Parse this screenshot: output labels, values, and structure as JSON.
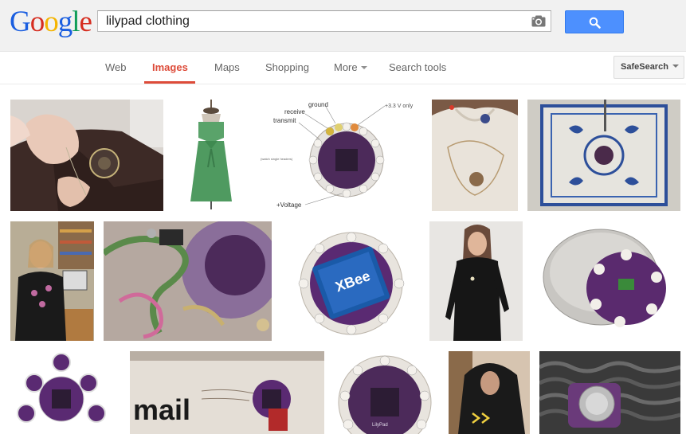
{
  "logo": {
    "letters": [
      "G",
      "o",
      "o",
      "g",
      "l",
      "e"
    ],
    "colors": [
      "#1a5ee0",
      "#d62d20",
      "#f4b400",
      "#1a5ee0",
      "#0f9d58",
      "#d62d20"
    ]
  },
  "search": {
    "query": "lilypad clothing",
    "camera_icon": "camera-icon",
    "button_icon": "magnifier-icon"
  },
  "nav": {
    "items": [
      {
        "label": "Web"
      },
      {
        "label": "Images",
        "active": true
      },
      {
        "label": "Maps"
      },
      {
        "label": "Shopping"
      },
      {
        "label": "More"
      },
      {
        "label": "Search tools"
      }
    ],
    "safesearch_label": "SafeSearch"
  },
  "colors": {
    "accent_active": "#dd4b39",
    "search_button": "#4d90fe",
    "nav_text": "#666666"
  },
  "image_results": {
    "diagram_labels": [
      "ground",
      "receive",
      "transmit",
      "+3.3 V only",
      "+Voltage",
      "(watch single headers)"
    ],
    "module_label": "XBee",
    "board_label": "LilyPad",
    "photo_text": "mail",
    "count": 15
  }
}
